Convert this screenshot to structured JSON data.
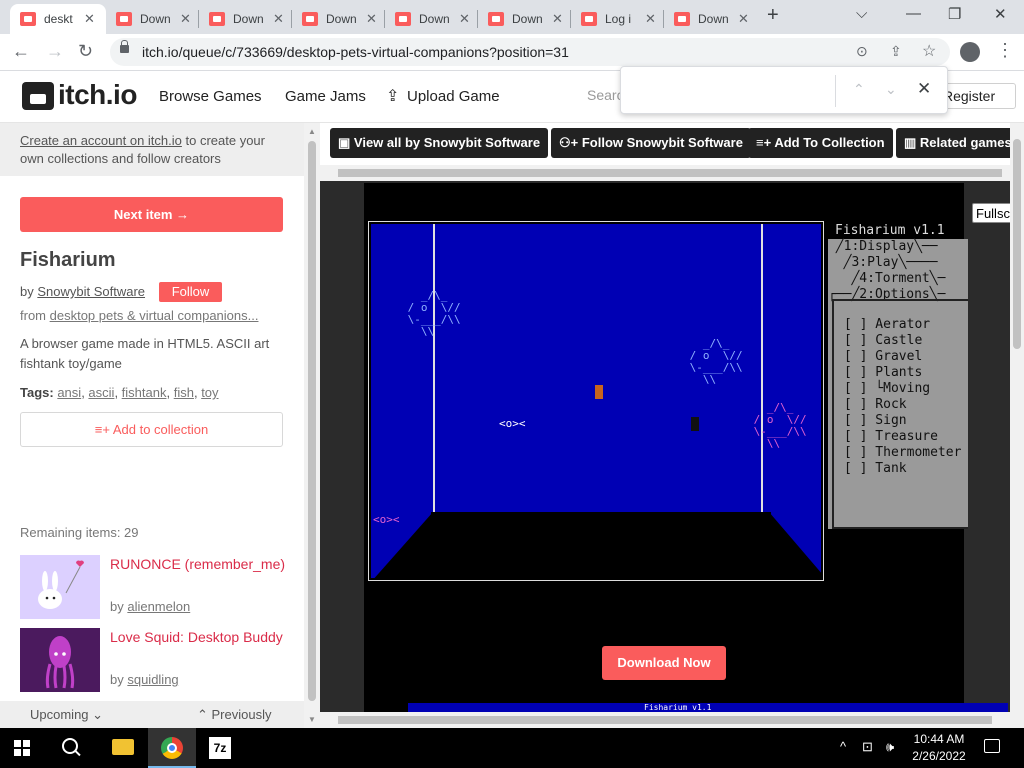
{
  "browser": {
    "tabs": [
      {
        "label": "deskt",
        "active": true
      },
      {
        "label": "Down",
        "active": false
      },
      {
        "label": "Down",
        "active": false
      },
      {
        "label": "Down",
        "active": false
      },
      {
        "label": "Down",
        "active": false
      },
      {
        "label": "Down",
        "active": false
      },
      {
        "label": "Log i",
        "active": false
      },
      {
        "label": "Down",
        "active": false
      }
    ],
    "url": "itch.io/queue/c/733669/desktop-pets-virtual-companions?position=31",
    "icons": {
      "back": "←",
      "forward": "→",
      "reload": "↻",
      "new_tab": "+",
      "minimize": "⌵",
      "restore": "❐",
      "close": "✕",
      "menu": "⋮",
      "share": "⇪",
      "star": "☆",
      "close_tab": "✕"
    }
  },
  "header": {
    "logo": "itch.io",
    "nav": [
      "Browse Games",
      "Game Jams",
      "Upload Game"
    ],
    "search_placeholder": "Search",
    "register": "Register"
  },
  "findbar": {
    "up": "⌃",
    "down": "⌄",
    "close": "✕"
  },
  "sidebar": {
    "account_link": "Create an account on itch.io",
    "account_text": " to create your own collections and follow creators",
    "next_item": "Next item →",
    "game_title": "Fisharium",
    "by": "by ",
    "author": "Snowybit Software",
    "follow": "Follow",
    "from": "from ",
    "collection": "desktop pets & virtual companions...",
    "description": "A browser game made in HTML5. ASCII art fishtank toy/game",
    "tags_label": "Tags: ",
    "tags": [
      "ansi",
      "ascii",
      "fishtank",
      "fish",
      "toy"
    ],
    "add_to_collection": "Add to collection",
    "remaining": "Remaining items: 29",
    "queue": [
      {
        "title": "RUNONCE (remember_me)",
        "by": "by ",
        "author": "alienmelon"
      },
      {
        "title": "Love Squid: Desktop Buddy",
        "by": "by ",
        "author": "squidling"
      }
    ],
    "upcoming": "Upcoming ⌄",
    "previously": "⌃ Previously"
  },
  "actions": [
    "View all by Snowybit Software",
    "Follow Snowybit Software",
    "Add To Collection",
    "Related games"
  ],
  "game": {
    "title": "Fisharium v1.1",
    "fullscreen": "Fullscreen",
    "menu_tabs": [
      " ╱1:Display╲──",
      "  ╱3:Play╲────",
      "   ╱4:Torment╲─",
      "┌──╱2:Options╲─"
    ],
    "options": [
      "[ ] Aerator",
      "[ ] Castle",
      "[ ] Gravel",
      "[ ] Plants",
      "[ ] └Moving",
      "[ ] Rock",
      "[ ] Sign",
      "[ ] Treasure",
      "[ ] Thermometer",
      "[ ] Tank"
    ],
    "fish_big": "   _/\\_\n / o  \\//\n \\-___/\\\\\n   \\\\",
    "fish_small": "<o><",
    "download": "Download Now",
    "strip_label": "Fisharium v1.1"
  },
  "taskbar": {
    "time": "10:44 AM",
    "date": "2/26/2022",
    "tray": [
      "^",
      "⊡",
      "🕪"
    ]
  },
  "colors": {
    "accent": "#fa5c5c",
    "water": "#0000b4",
    "link_pink": "#da2c49"
  }
}
